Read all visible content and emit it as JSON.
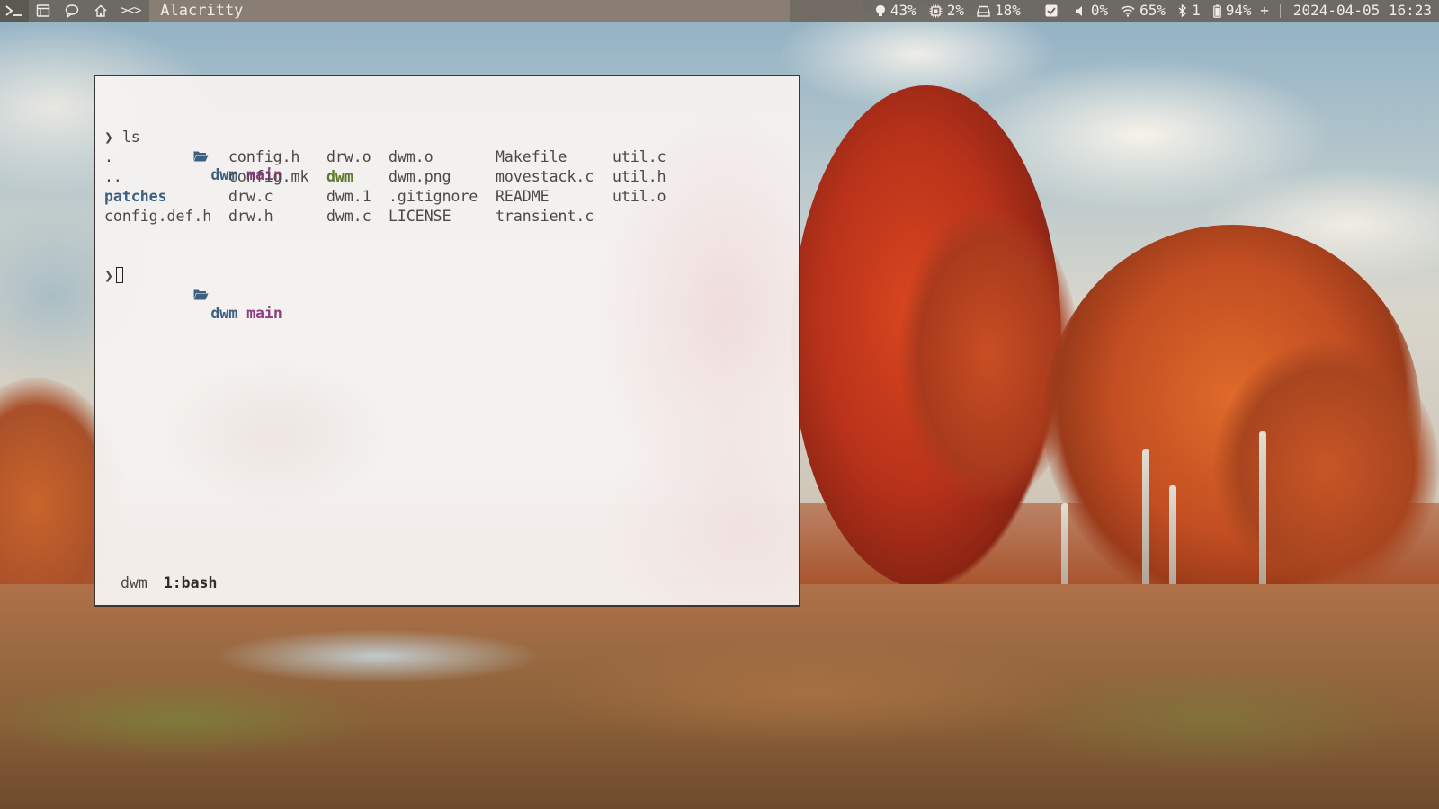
{
  "topbar": {
    "tags": [
      {
        "name": "terminal-tag-icon",
        "glyph": ">_"
      },
      {
        "name": "window-tag-icon",
        "glyph": "window"
      },
      {
        "name": "chat-tag-icon",
        "glyph": "chat"
      },
      {
        "name": "home-tag-icon",
        "glyph": "home"
      }
    ],
    "layout_symbol": "><>",
    "window_title": "Alacritty",
    "status": {
      "memory": "43%",
      "cpu": "2%",
      "disk": "18%",
      "volume": "0%",
      "wifi": "65%",
      "bluetooth": "1",
      "battery": "94% +",
      "datetime": "2024-04-05 16:23"
    }
  },
  "terminal": {
    "prompt1": {
      "dir": "dwm",
      "branch": "main",
      "command": "ls"
    },
    "ls_output": [
      [
        ".",
        "config.h",
        "drw.o",
        "dwm.o",
        "Makefile",
        "util.c"
      ],
      [
        "..",
        "config.mk",
        "dwm",
        "dwm.png",
        "movestack.c",
        "util.h"
      ],
      [
        "patches",
        "drw.c",
        "dwm.1",
        ".gitignore",
        "README",
        "util.o"
      ],
      [
        "config.def.h",
        "drw.h",
        "dwm.c",
        "LICENSE",
        "transient.c",
        ""
      ]
    ],
    "prompt2": {
      "dir": "dwm",
      "branch": "main"
    },
    "chevron": "❯",
    "tmux": {
      "session": "dwm",
      "window": "1:bash"
    }
  },
  "colors": {
    "directory": "#3d5f80",
    "branch": "#8e3f83",
    "executable": "#5f7a2c"
  }
}
